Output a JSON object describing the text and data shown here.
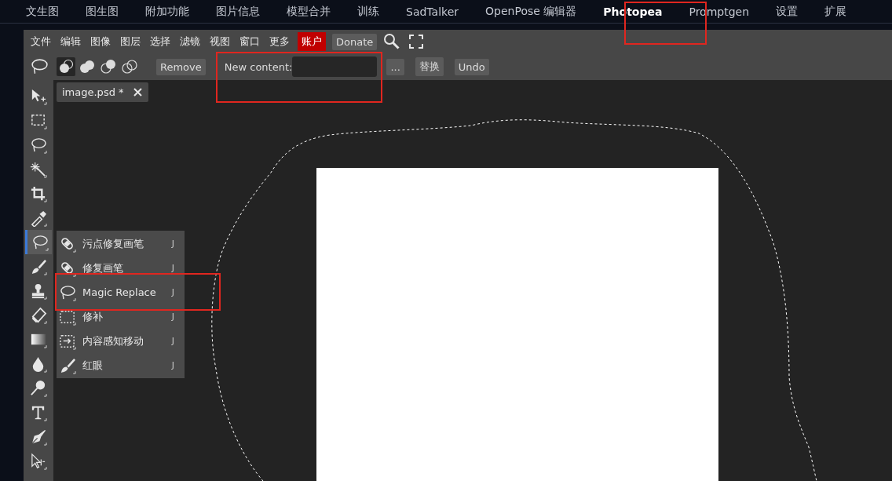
{
  "top_tabs": [
    {
      "label": "文生图",
      "selected": false
    },
    {
      "label": "图生图",
      "selected": false
    },
    {
      "label": "附加功能",
      "selected": false
    },
    {
      "label": "图片信息",
      "selected": false
    },
    {
      "label": "模型合并",
      "selected": false
    },
    {
      "label": "训练",
      "selected": false
    },
    {
      "label": "SadTalker",
      "selected": false
    },
    {
      "label": "OpenPose 编辑器",
      "selected": false
    },
    {
      "label": "Photopea",
      "selected": true
    },
    {
      "label": "Promptgen",
      "selected": false
    },
    {
      "label": "设置",
      "selected": false
    },
    {
      "label": "扩展",
      "selected": false
    }
  ],
  "menu": [
    "文件",
    "编辑",
    "图像",
    "图层",
    "选择",
    "滤镜",
    "视图",
    "窗口",
    "更多"
  ],
  "account_button": "账户",
  "donate_button": "Donate",
  "options_bar": {
    "modes": [
      {
        "selected": true
      },
      {
        "selected": false
      },
      {
        "selected": false
      },
      {
        "selected": false
      }
    ],
    "remove_button": "Remove",
    "new_content_label": "New content:",
    "more_button": "...",
    "replace_button": "替换",
    "undo_button": "Undo"
  },
  "document_tab": {
    "title": "image.psd *"
  },
  "tools": [
    {
      "kind": "move",
      "selected": false
    },
    {
      "kind": "marquee",
      "selected": false
    },
    {
      "kind": "lasso",
      "selected": false
    },
    {
      "kind": "wand",
      "selected": false
    },
    {
      "kind": "crop",
      "selected": false
    },
    {
      "kind": "eyedropper",
      "selected": false
    },
    {
      "kind": "lasso",
      "selected": true
    },
    {
      "kind": "brush",
      "selected": false
    },
    {
      "kind": "stamp",
      "selected": false
    },
    {
      "kind": "eraser",
      "selected": false
    },
    {
      "kind": "gradient",
      "selected": false
    },
    {
      "kind": "drop",
      "selected": false
    },
    {
      "kind": "dodge",
      "selected": false
    },
    {
      "kind": "type",
      "selected": false
    },
    {
      "kind": "pen",
      "selected": false
    },
    {
      "kind": "select",
      "selected": false
    }
  ],
  "flyout": [
    {
      "kind": "bandage",
      "label": "污点修复画笔",
      "shortcut": "J"
    },
    {
      "kind": "bandage",
      "label": "修复画笔",
      "shortcut": "J"
    },
    {
      "kind": "lasso",
      "label": "Magic Replace",
      "shortcut": "J"
    },
    {
      "kind": "patch",
      "label": "修补",
      "shortcut": "J"
    },
    {
      "kind": "move-patch",
      "label": "内容感知移动",
      "shortcut": "J"
    },
    {
      "kind": "brush",
      "label": "红眼",
      "shortcut": "J"
    }
  ]
}
